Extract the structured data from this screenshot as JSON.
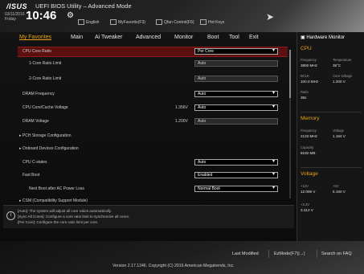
{
  "header": {
    "logo": "/ISUS",
    "title": "UEFI BIOS Utility – Advanced Mode",
    "date": "03/11/2016",
    "day": "Friday",
    "time": "10:46",
    "links": [
      "English",
      "MyFavorite(F3)",
      "Qfan Control(F6)",
      "Hot Keys"
    ]
  },
  "tabs": [
    "My Favorites",
    "Main",
    "Ai Tweaker",
    "Advanced",
    "Monitor",
    "Boot",
    "Tool",
    "Exit"
  ],
  "settings": [
    {
      "label": "CPU Core Ratio",
      "value": "Per Core",
      "kind": "dropdown",
      "selected": true
    },
    {
      "label": "1-Core Ratio Limit",
      "value": "Auto",
      "kind": "field",
      "indent": true
    },
    {
      "label": "2-Core Ratio Limit",
      "value": "Auto",
      "kind": "field",
      "indent": true
    },
    {
      "label": "DRAM Frequency",
      "value": "Auto",
      "kind": "dropdown"
    },
    {
      "label": "CPU Core/Cache Voltage",
      "reading": "1.356V",
      "value": "Auto",
      "kind": "dropdown"
    },
    {
      "label": "DRAM Voltage",
      "reading": "1.200V",
      "value": "Auto",
      "kind": "field"
    },
    {
      "label": "PCH Storage Configuration",
      "kind": "submenu"
    },
    {
      "label": "Onboard Devices Configuration",
      "kind": "submenu"
    },
    {
      "label": "CPU C-states",
      "value": "Auto",
      "kind": "dropdown"
    },
    {
      "label": "Fast Boot",
      "value": "Enabled",
      "kind": "dropdown"
    },
    {
      "label": "Next Boot after AC Power Loss",
      "value": "Normal Boot",
      "kind": "dropdown",
      "indent": true
    },
    {
      "label": "CSM (Compatibility Support Module)",
      "kind": "submenu"
    }
  ],
  "monitor": {
    "title": "Hardware Monitor",
    "cpu": {
      "section": "CPU",
      "frequency_label": "Frequency",
      "frequency": "3800 MHz",
      "temperature_label": "Temperature",
      "temperature": "36°C",
      "bclk_label": "BCLK",
      "bclk": "100.0 MHz",
      "core_voltage_label": "Core Voltage",
      "core_voltage": "1.200 V",
      "ratio_label": "Ratio",
      "ratio": "38x"
    },
    "memory": {
      "section": "Memory",
      "frequency_label": "Frequency",
      "frequency": "2133 MHz",
      "voltage_label": "Voltage",
      "voltage": "1.184 V",
      "capacity_label": "Capacity",
      "capacity": "8192 MB"
    },
    "voltage": {
      "section": "Voltage",
      "v12_label": "+12V",
      "v12": "12.096 V",
      "v5_label": "+5V",
      "v5": "5.160 V",
      "v33_label": "+3.3V",
      "v33": "3.312 V"
    }
  },
  "help": {
    "line1": "[Auto]: The system will adjust all core ratios automatically.",
    "line2": "[Sync All Cores]: Configure a core ratio limit to synchronize all cores.",
    "line3": "[Per Core]: Configure the core ratio limit per core."
  },
  "footer": {
    "last_modified": "Last Modified",
    "ezmode": "EzMode(F7)|→|",
    "search": "Search on FAQ",
    "version": "Version 2.17.1246. Copyright (C) 2016 American Megatrends, Inc."
  }
}
